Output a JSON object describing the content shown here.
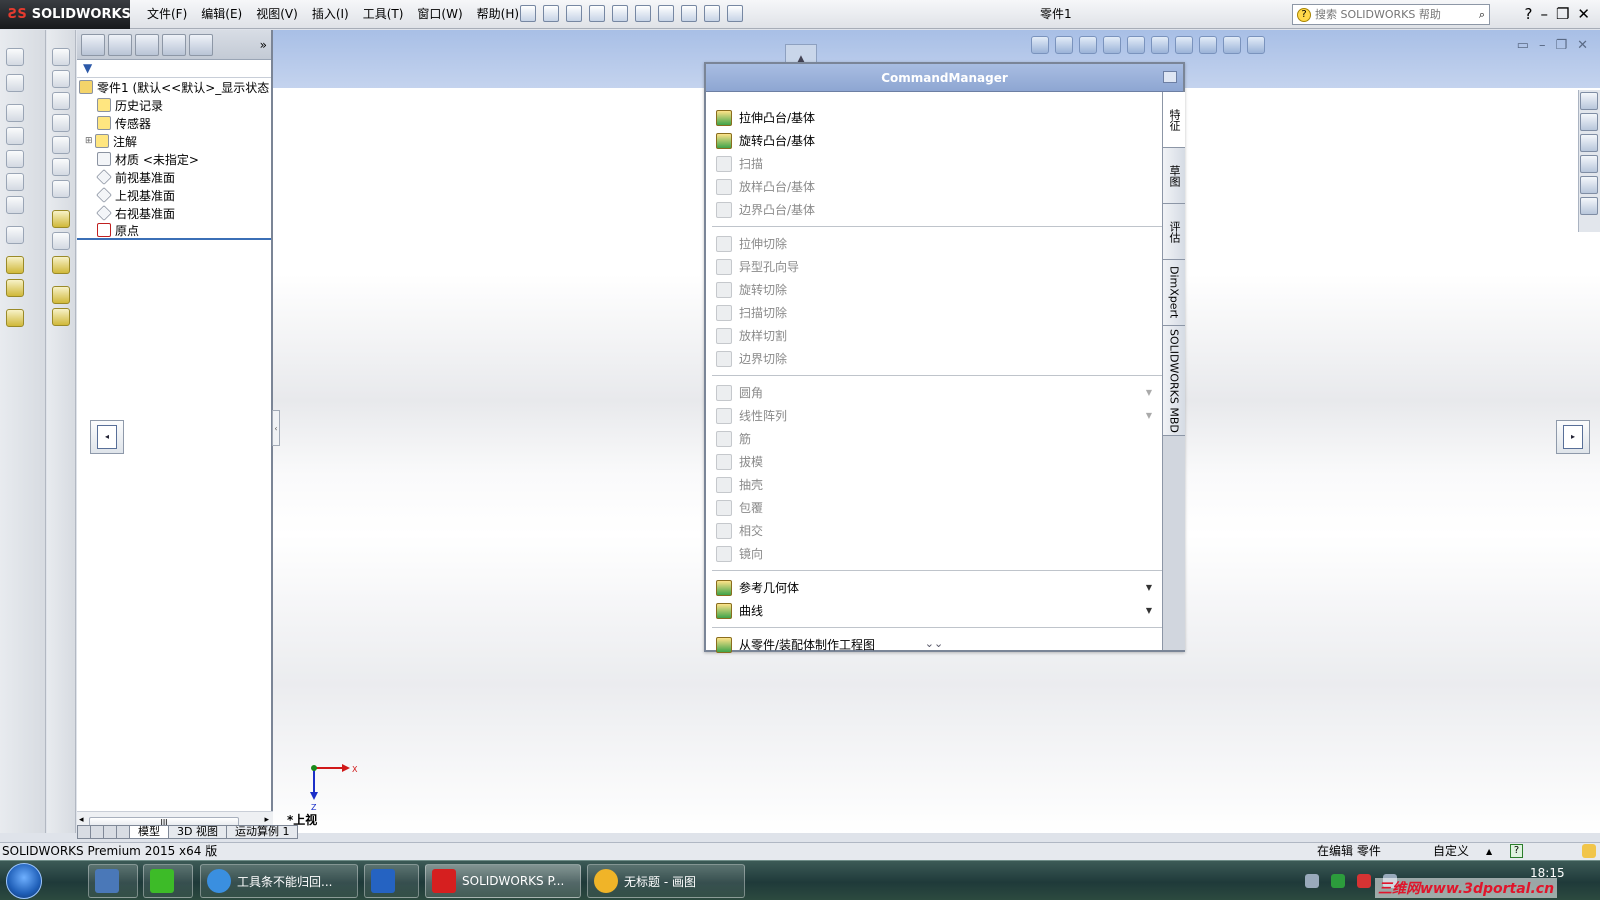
{
  "window": {
    "logo": "SOLIDWORKS",
    "doc_title": "零件1",
    "menus": [
      "文件(F)",
      "编辑(E)",
      "视图(V)",
      "插入(I)",
      "工具(T)",
      "窗口(W)",
      "帮助(H)"
    ],
    "search_placeholder": "搜索 SOLIDWORKS 帮助"
  },
  "feature_manager": {
    "tree": [
      {
        "label": "零件1  (默认<<默认>_显示状态",
        "icon": "part-icon"
      },
      {
        "label": "历史记录",
        "icon": "history-icon"
      },
      {
        "label": "传感器",
        "icon": "sensor-icon"
      },
      {
        "label": "注解",
        "icon": "annotation-icon"
      },
      {
        "label": "材质 <未指定>",
        "icon": "material-icon"
      },
      {
        "label": "前视基准面",
        "icon": "plane-icon"
      },
      {
        "label": "上视基准面",
        "icon": "plane-icon"
      },
      {
        "label": "右视基准面",
        "icon": "plane-icon"
      },
      {
        "label": "原点",
        "icon": "origin-icon"
      }
    ],
    "scroll_grip": "III"
  },
  "view_tabs": [
    "模型",
    "3D 视图",
    "运动算例 1"
  ],
  "command_manager": {
    "title": "CommandManager",
    "items": [
      "拉伸凸台/基体",
      "旋转凸台/基体",
      "扫描",
      "放样凸台/基体",
      "边界凸台/基体",
      "拉伸切除",
      "异型孔向导",
      "旋转切除",
      "扫描切除",
      "放样切割",
      "边界切除",
      "圆角",
      "线性阵列",
      "筋",
      "拔模",
      "抽壳",
      "包覆",
      "相交",
      "镜向",
      "参考几何体",
      "曲线",
      "从零件/装配体制作工程图"
    ],
    "tabs": [
      "特征",
      "草图",
      "评估",
      "DimXpert",
      "SOLIDWORKS MBD"
    ]
  },
  "viewport": {
    "view_name": "*上视",
    "axis_x": "X",
    "axis_z": "Z"
  },
  "status": {
    "product": "SOLIDWORKS Premium 2015 x64 版",
    "editing": "在编辑 零件",
    "units": "自定义"
  },
  "taskbar": {
    "apps": [
      "工具条不能归回...",
      "SOLIDWORKS P...",
      "无标题 - 画图"
    ],
    "clock": "18:15",
    "watermark": "三维网www.3dportal.cn"
  },
  "colors": {
    "accent": "#a8bfe6",
    "brand_red": "#e53b2f"
  }
}
